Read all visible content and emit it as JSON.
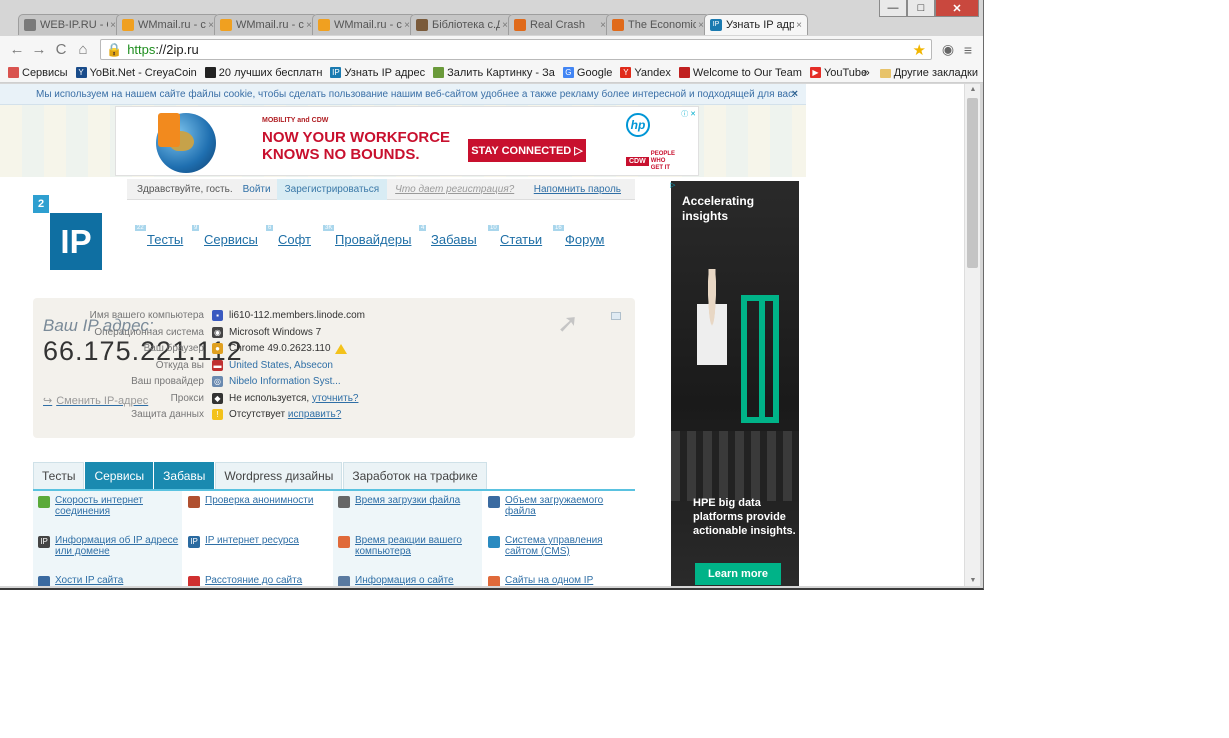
{
  "window": {
    "min_label": "—",
    "max_label": "□",
    "close_label": "✕"
  },
  "tabs": [
    {
      "title": "WEB-IP.RU - Oп",
      "fav_color": "#7a7a7a",
      "close": "×"
    },
    {
      "title": "WMmail.ru - ce",
      "fav_color": "#f0a020",
      "close": "×"
    },
    {
      "title": "WMmail.ru - ce",
      "fav_color": "#f0a020",
      "close": "×"
    },
    {
      "title": "WMmail.ru - ce",
      "fav_color": "#f0a020",
      "close": "×"
    },
    {
      "title": "Бібліотека с.Д",
      "fav_color": "#7a5a3a",
      "close": "×"
    },
    {
      "title": "Real Crash",
      "fav_color": "#e06a1a",
      "close": "×"
    },
    {
      "title": "The Economic",
      "fav_color": "#e06a1a",
      "close": "×"
    },
    {
      "title": "Узнать IP адре",
      "fav_color": "#1a7ab0",
      "fav_text": "IP",
      "close": "×"
    }
  ],
  "toolbar": {
    "back_label": "←",
    "forward_label": "→",
    "reload_label": "C",
    "home_label": "⌂",
    "url_scheme": "https",
    "url_rest": "://2ip.ru",
    "star_label": "★",
    "ext_label": "◉",
    "menu_label": "≡"
  },
  "bookmarks": {
    "items": [
      {
        "label": "Сервисы",
        "color": "#d9534f"
      },
      {
        "label": "YoBit.Net - CreyaCoin",
        "color": "#1a4c8a",
        "icon": "Y"
      },
      {
        "label": "20 лучших бесплатн",
        "color": "#222222"
      },
      {
        "label": "Узнать IP адрес",
        "color": "#1a7ab0",
        "icon": "IP"
      },
      {
        "label": "Залить Картинку - За",
        "color": "#6a9a3a"
      },
      {
        "label": "Google",
        "color": "#4285f4",
        "icon": "G"
      },
      {
        "label": "Yandex",
        "color": "#e02a1a",
        "icon": "Y"
      },
      {
        "label": "Welcome to Our Team",
        "color": "#c02020"
      },
      {
        "label": "YouTube",
        "color": "#e52d27",
        "icon": "▶"
      }
    ],
    "more_label": "»",
    "other_label": "Другие закладки"
  },
  "page": {
    "cookie_text": "Мы используем на нашем сайте файлы cookie, чтобы сделать пользование нашим веб-сайтом удобнее а также рекламу более интересной и подходящей для вас.",
    "cookie_close": "×",
    "top_ad": {
      "kicker": "MOBILITY and CDW",
      "headline": "NOW YOUR WORKFORCE KNOWS NO BOUNDS.",
      "button": "STAY CONNECTED ▷",
      "hp": "hp",
      "cdw": "CDW",
      "cdw_tag": "PEOPLE WHO GET IT",
      "adchoices": "ⓘ ✕"
    },
    "auth": {
      "greeting": "Здравствуйте, гость.",
      "login": "Войти",
      "register": "Зарегистрироваться",
      "why": "Что дает регистрация?",
      "forgot": "Напомнить пароль"
    },
    "logo": {
      "small": "2",
      "big": "IP"
    },
    "menu": [
      {
        "label": "Тесты",
        "badge": "22"
      },
      {
        "label": "Сервисы",
        "badge": "9"
      },
      {
        "label": "Софт",
        "badge": "6"
      },
      {
        "label": "Провайдеры",
        "badge": "3K"
      },
      {
        "label": "Забавы",
        "badge": "4"
      },
      {
        "label": "Статьи",
        "badge": "10"
      },
      {
        "label": "Форум",
        "badge": "16"
      }
    ],
    "ip": {
      "label": "Ваш IP адрес:",
      "address": "66.175.221.112",
      "change": "Сменить IP-адрес",
      "rows": [
        {
          "key": "Имя вашего компьютера",
          "value": "li610-112.members.linode.com",
          "icon_color": "#3a5ac0",
          "icon": "▪"
        },
        {
          "key": "Операционная система",
          "value": "Microsoft Windows 7",
          "icon_color": "#444444",
          "icon": "◉"
        },
        {
          "key": "Ваш браузер",
          "value": "Chrome 49.0.2623.110",
          "icon_color": "#e0a020",
          "icon": "●"
        },
        {
          "key": "Откуда вы",
          "value": "United States, Absecon",
          "icon_color": "#c03030",
          "icon": "▬"
        },
        {
          "key": "Ваш провайдер",
          "value": "Nibelo Information Syst...",
          "icon_color": "#6a8ab0",
          "icon": "◎"
        },
        {
          "key": "Прокси",
          "value": "Не используется,",
          "extra": "уточнить?",
          "icon_color": "#333333",
          "icon": "◆"
        },
        {
          "key": "Защита данных",
          "value": "Отсутствует",
          "extra": "исправить?",
          "icon_color": "#f3c21b",
          "icon": "!"
        }
      ]
    },
    "section_tabs": [
      "Тесты",
      "Сервисы",
      "Забавы",
      "Wordpress дизайны",
      "Заработок на трафике"
    ],
    "services": [
      {
        "label": "Скорость интернет соединения",
        "color": "#5aaa3a"
      },
      {
        "label": "Проверка анонимности",
        "color": "#b05030"
      },
      {
        "label": "Время загрузки файла",
        "color": "#666666"
      },
      {
        "label": "Объем загружаемого файла",
        "color": "#3a6aa0"
      },
      {
        "label": "Информация об IP адресе или домене",
        "color": "#444444",
        "icon": "IP"
      },
      {
        "label": "IP интернет ресурса",
        "color": "#2a6aa0",
        "icon": "IP"
      },
      {
        "label": "Время реакции вашего компьютера",
        "color": "#e06a3a"
      },
      {
        "label": "Система управления сайтом (CMS)",
        "color": "#2a8ac0"
      },
      {
        "label": "Хости IP сайта",
        "color": "#3a6aa0"
      },
      {
        "label": "Расстояние до сайта",
        "color": "#d03030"
      },
      {
        "label": "Информация о сайте",
        "color": "#5a7aa0"
      },
      {
        "label": "Сайты на одном IP",
        "color": "#e06a3a"
      }
    ],
    "side_ad": {
      "adchoices": "▷",
      "headline": "Accelerating insights",
      "body": "HPE big data platforms provide actionable insights.",
      "button": "Learn more"
    }
  }
}
